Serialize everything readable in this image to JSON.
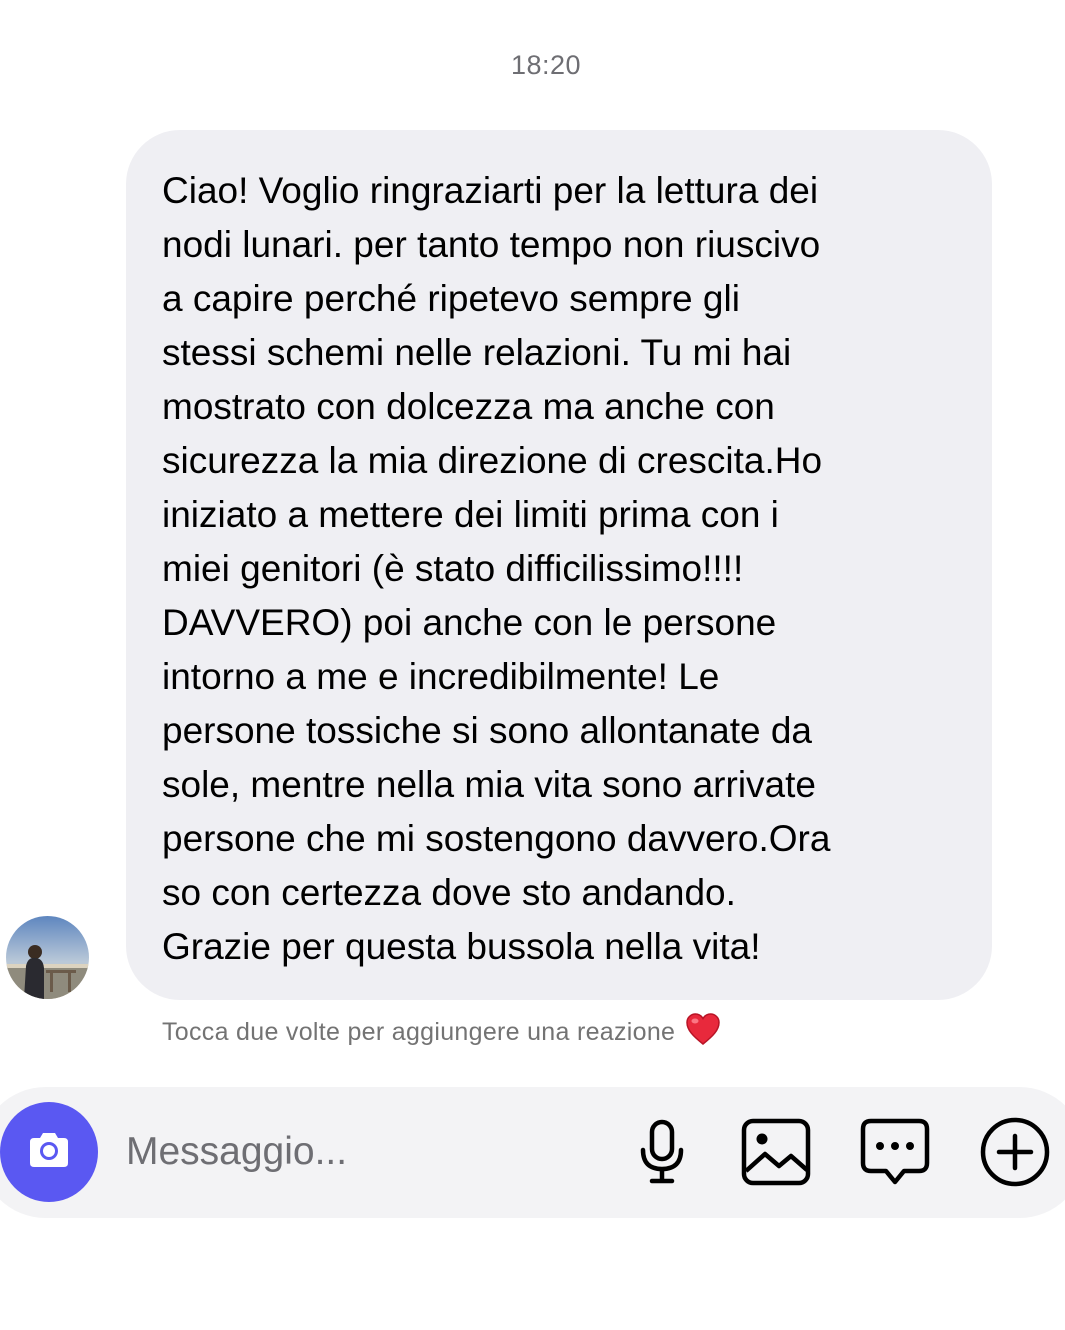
{
  "chat": {
    "timestamp": "18:20",
    "message": {
      "text": "Ciao! Voglio ringraziarti per la lettura dei\nnodi lunari. per tanto tempo non riuscivo\na capire perché ripetevo sempre gli\nstessi schemi nelle relazioni. Tu mi hai\nmostrato con dolcezza ma anche con\nsicurezza la mia direzione di crescita.Ho\niniziato a mettere dei limiti prima con i\nmiei genitori (è stato difficilissimo!!!!\nDAVVERO) poi anche con le persone\nintorno a me e incredibilmente! Le\npersone tossiche si sono allontanate da\nsole, mentre nella mia vita sono arrivate\npersone che mi sostengono davvero.Ora\nso con certezza dove sto andando.\nGrazie per questa bussola nella vita!",
      "bubble_color": "#efeff3"
    },
    "reaction_hint": "Tocca due volte per aggiungere una reazione",
    "reaction_icon": "heart-icon"
  },
  "composer": {
    "placeholder": "Messaggio...",
    "camera_icon": "camera-icon",
    "camera_color": "#5a58f2",
    "actions": [
      {
        "icon": "microphone-icon"
      },
      {
        "icon": "image-icon"
      },
      {
        "icon": "sticker-chat-icon"
      },
      {
        "icon": "plus-circle-icon"
      }
    ]
  }
}
